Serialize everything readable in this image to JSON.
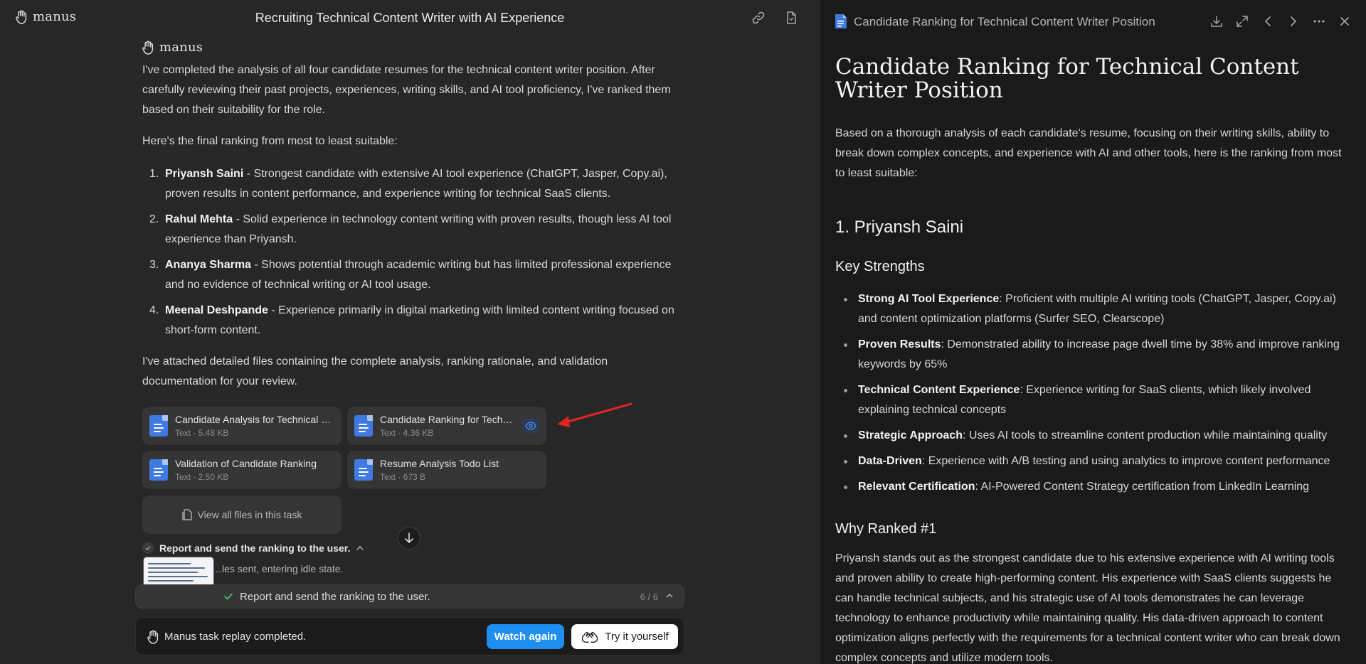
{
  "app": {
    "logo_text": "manus"
  },
  "header": {
    "title": "Recruiting Technical Content Writer with AI Experience"
  },
  "chat": {
    "agent_name": "manus",
    "intro": "I've completed the analysis of all four candidate resumes for the technical content writer position. After carefully reviewing their past projects, experiences, writing skills, and AI tool proficiency, I've ranked them based on their suitability for the role.",
    "ranking_lead": "Here's the final ranking from most to least suitable:",
    "ranking": [
      {
        "num": "1.",
        "name": "Priyansh Saini",
        "desc": " - Strongest candidate with extensive AI tool experience (ChatGPT, Jasper, Copy.ai), proven results in content performance, and experience writing for technical SaaS clients."
      },
      {
        "num": "2.",
        "name": "Rahul Mehta",
        "desc": " - Solid experience in technology content writing with proven results, though less AI tool experience than Priyansh."
      },
      {
        "num": "3.",
        "name": "Ananya Sharma",
        "desc": " - Shows potential through academic writing but has limited professional experience and no evidence of technical writing or AI tool usage."
      },
      {
        "num": "4.",
        "name": "Meenal Deshpande",
        "desc": " - Experience primarily in digital marketing with limited content writing focused on short-form content."
      }
    ],
    "attach_lead": "I've attached detailed files containing the complete analysis, ranking rationale, and validation documentation for your review."
  },
  "files": [
    {
      "name": "Candidate Analysis for Technical Content Writer",
      "size": "Text · 5.48 KB"
    },
    {
      "name": "Candidate Ranking for Technical Content Writer Position",
      "size": "Text · 4.36 KB"
    },
    {
      "name": "Validation of Candidate Ranking",
      "size": "Text · 2.50 KB"
    },
    {
      "name": "Resume Analysis Todo List",
      "size": "Text · 673 B"
    }
  ],
  "view_all_label": "View all files in this task",
  "step": {
    "label": "Report and send the ranking to the user.",
    "sub": "…les sent, entering idle state."
  },
  "status": {
    "text": "Report and send the ranking to the user.",
    "count": "6 / 6"
  },
  "replay": {
    "label": "Manus task replay completed.",
    "watch_again": "Watch again",
    "try_it": "Try it yourself"
  },
  "doc": {
    "header_title": "Candidate Ranking for Technical Content Writer Position",
    "h1": "Candidate Ranking for Technical Content Writer Position",
    "intro": "Based on a thorough analysis of each candidate's resume, focusing on their writing skills, ability to break down complex concepts, and experience with AI and other tools, here is the ranking from most to least suitable:",
    "h2": "1. Priyansh Saini",
    "h3": "Key Strengths",
    "strengths": [
      {
        "label": "Strong AI Tool Experience",
        "text": ": Proficient with multiple AI writing tools (ChatGPT, Jasper, Copy.ai) and content optimization platforms (Surfer SEO, Clearscope)"
      },
      {
        "label": "Proven Results",
        "text": ": Demonstrated ability to increase page dwell time by 38% and improve ranking keywords by 65%"
      },
      {
        "label": "Technical Content Experience",
        "text": ": Experience writing for SaaS clients, which likely involved explaining technical concepts"
      },
      {
        "label": "Strategic Approach",
        "text": ": Uses AI tools to streamline content production while maintaining quality"
      },
      {
        "label": "Data-Driven",
        "text": ": Experience with A/B testing and using analytics to improve content performance"
      },
      {
        "label": "Relevant Certification",
        "text": ": AI-Powered Content Strategy certification from LinkedIn Learning"
      }
    ],
    "h3b": "Why Ranked #1",
    "why": "Priyansh stands out as the strongest candidate due to his extensive experience with AI writing tools and proven ability to create high-performing content. His experience with SaaS clients suggests he can handle technical subjects, and his strategic use of AI tools demonstrates he can leverage technology to enhance productivity while maintaining quality. His data-driven approach to content optimization aligns perfectly with the requirements for a technical content writer who can break down complex concepts and utilize modern tools."
  },
  "colors": {
    "accent": "#1f8ef1",
    "doc_blue": "#3f7ae0",
    "annotation_arrow": "#e02424"
  }
}
